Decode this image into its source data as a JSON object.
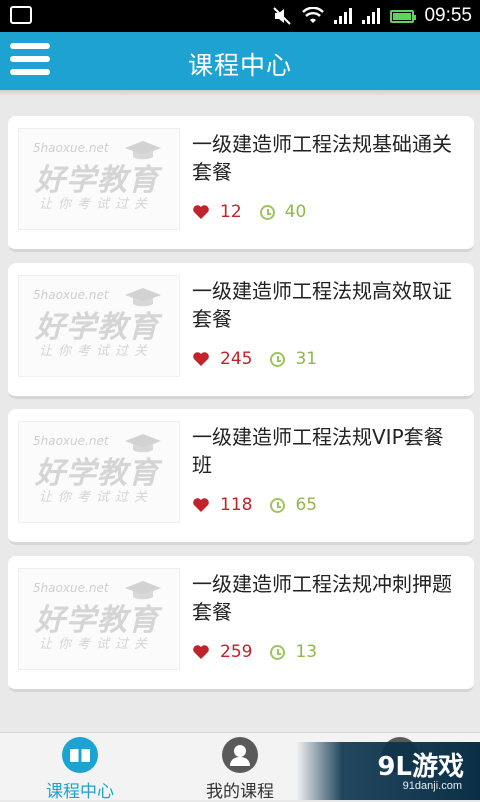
{
  "status_bar": {
    "time": "09:55",
    "icons": [
      "image-notification-icon",
      "mute-icon",
      "wifi-icon",
      "signal-icon",
      "signal-icon",
      "battery-icon"
    ],
    "battery_color": "#5bd65b"
  },
  "header": {
    "title": "课程中心",
    "menu_icon": "hamburger-menu-icon",
    "color": "#1da2d2"
  },
  "courses": [
    {
      "title": "一级建造师工程法规基础通关套餐",
      "likes": "12",
      "duration": "40"
    },
    {
      "title": "一级建造师工程法规高效取证套餐",
      "likes": "245",
      "duration": "31"
    },
    {
      "title": "一级建造师工程法规VIP套餐班",
      "likes": "118",
      "duration": "65"
    },
    {
      "title": "一级建造师工程法规冲刺押题套餐",
      "likes": "259",
      "duration": "13"
    }
  ],
  "thumbnail": {
    "site": "5haoxue.net",
    "brand": "好学教育",
    "slogan": "让你考试过关"
  },
  "tabs": [
    {
      "label": "课程中心",
      "icon": "book-icon",
      "active": true
    },
    {
      "label": "我的课程",
      "icon": "user-icon",
      "active": false
    },
    {
      "label": "",
      "icon": "more-icon",
      "active": false
    }
  ],
  "watermark": {
    "logo": "9L游戏",
    "url": "91danji.com"
  },
  "colors": {
    "accent": "#1da2d2",
    "heart": "#c0232a",
    "clock": "#8fb84a"
  }
}
